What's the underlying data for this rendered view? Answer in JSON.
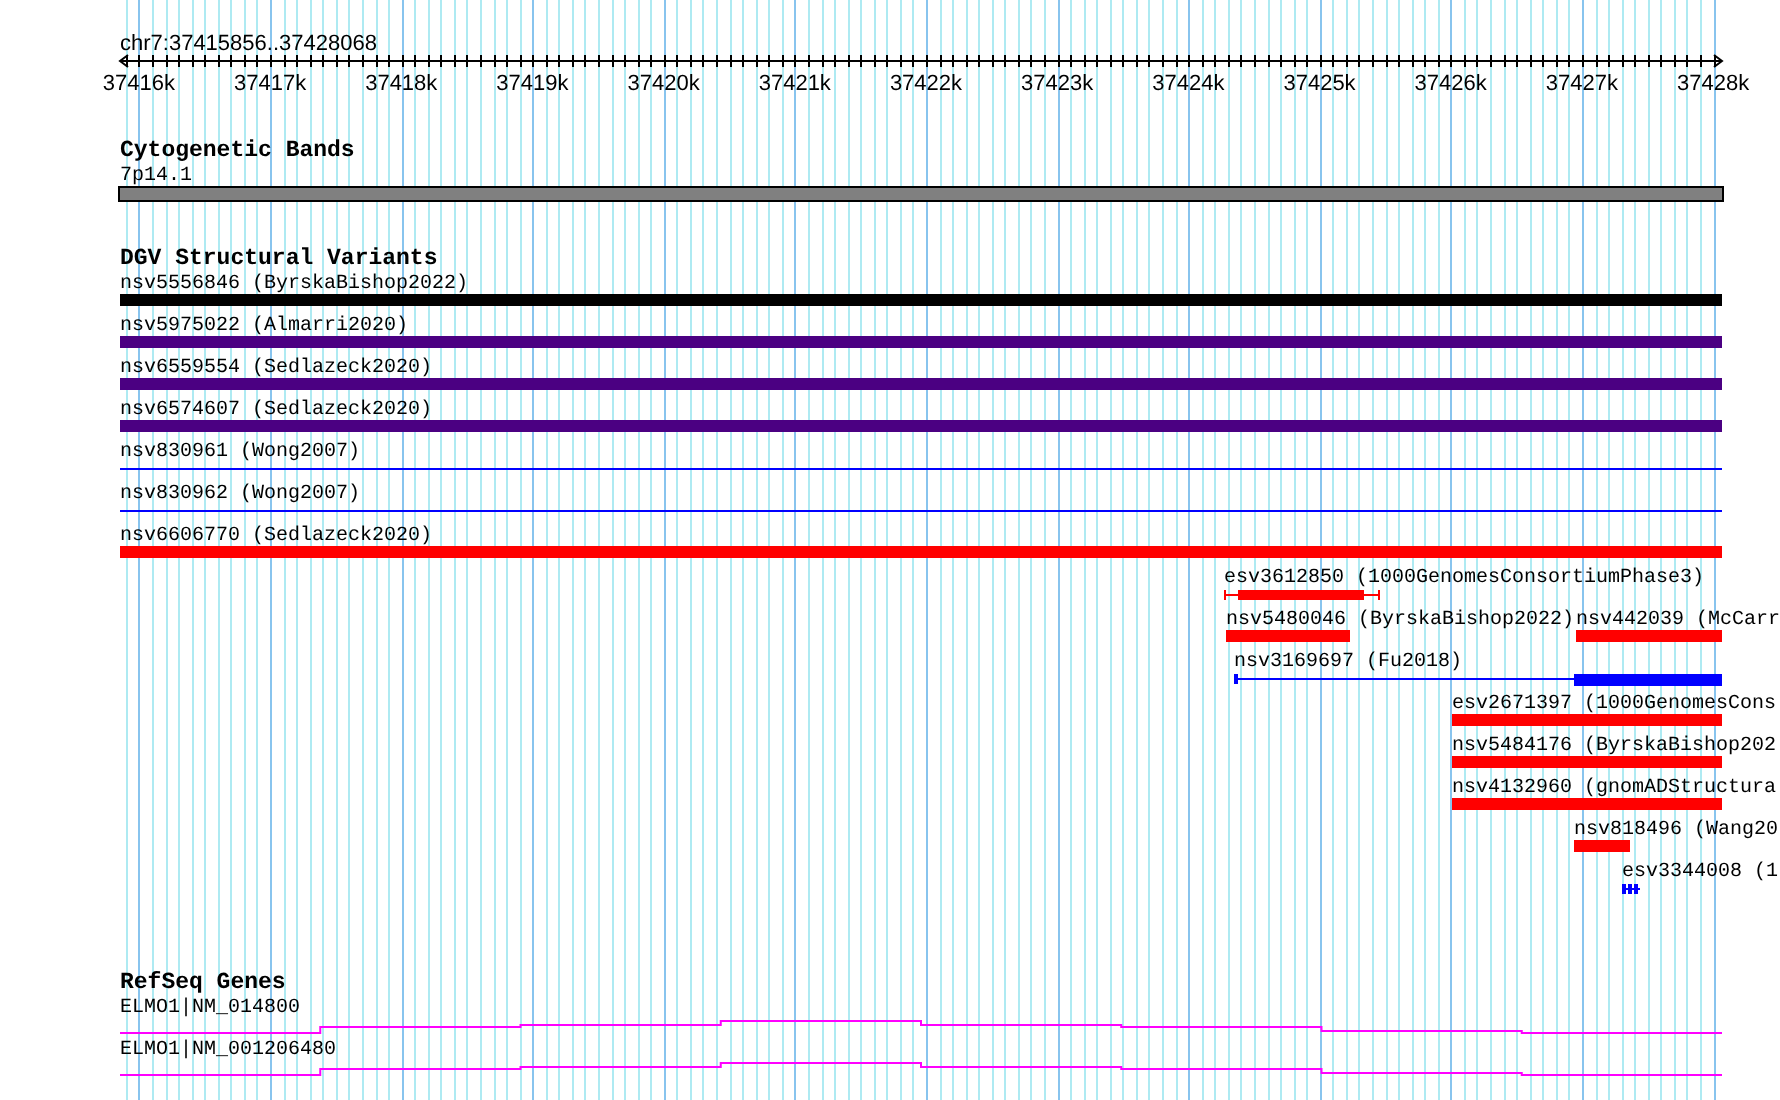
{
  "ruler": {
    "locus": "chr7:37415856..37428068",
    "ticks": [
      "37416k",
      "37417k",
      "37418k",
      "37419k",
      "37420k",
      "37421k",
      "37422k",
      "37423k",
      "37424k",
      "37425k",
      "37426k",
      "37427k",
      "37428k"
    ]
  },
  "tracks": [
    {
      "title": "Cytogenetic Bands",
      "rows": [
        [
          {
            "label": "7p14.1",
            "kind": "band",
            "color": "#808080"
          }
        ]
      ]
    },
    {
      "title": "DGV Structural Variants",
      "rows": [
        [
          {
            "label": "nsv5556846 (ByrskaBishop2022)",
            "kind": "bar",
            "color": "#000000"
          }
        ],
        [
          {
            "label": "nsv5975022 (Almarri2020)",
            "kind": "bar",
            "color": "#4b0082"
          }
        ],
        [
          {
            "label": "nsv6559554 (Sedlazeck2020)",
            "kind": "bar",
            "color": "#4b0082"
          }
        ],
        [
          {
            "label": "nsv6574607 (Sedlazeck2020)",
            "kind": "bar",
            "color": "#4b0082"
          }
        ],
        [
          {
            "label": "nsv830961 (Wong2007)",
            "kind": "line",
            "color": "#0000ff"
          }
        ],
        [
          {
            "label": "nsv830962 (Wong2007)",
            "kind": "line",
            "color": "#0000ff"
          }
        ],
        [
          {
            "label": "nsv6606770 (Sedlazeck2020)",
            "kind": "bar",
            "color": "#ff0000"
          }
        ],
        [
          {
            "label": "esv3612850 (1000GenomesConsortiumPhase3)",
            "kind": "whisker",
            "color": "#ff0000"
          }
        ],
        [
          {
            "label": "nsv5480046 (ByrskaBishop2022)",
            "kind": "bar",
            "color": "#ff0000"
          },
          {
            "label": "nsv442039 (McCarr",
            "kind": "bar",
            "color": "#ff0000"
          }
        ],
        [
          {
            "label": "nsv3169697 (Fu2018)",
            "kind": "split",
            "color": "#0000ff"
          }
        ],
        [
          {
            "label": "esv2671397 (1000GenomesCons",
            "kind": "bar",
            "color": "#ff0000"
          }
        ],
        [
          {
            "label": "nsv5484176 (ByrskaBishop202",
            "kind": "bar",
            "color": "#ff0000"
          }
        ],
        [
          {
            "label": "nsv4132960 (gnomADStructura",
            "kind": "bar",
            "color": "#ff0000"
          }
        ],
        [
          {
            "label": "nsv818496 (Wang20",
            "kind": "bar",
            "color": "#ff0000"
          }
        ],
        [
          {
            "label": "esv3344008 (1",
            "kind": "ticks",
            "color": "#0000ff"
          }
        ]
      ]
    },
    {
      "title": "RefSeq Genes",
      "rows": [
        [
          {
            "label": "ELMO1|NM_014800",
            "kind": "gene",
            "color": "#ff00ff"
          }
        ],
        [
          {
            "label": "ELMO1|NM_001206480",
            "kind": "gene",
            "color": "#ff00ff"
          }
        ]
      ]
    }
  ]
}
